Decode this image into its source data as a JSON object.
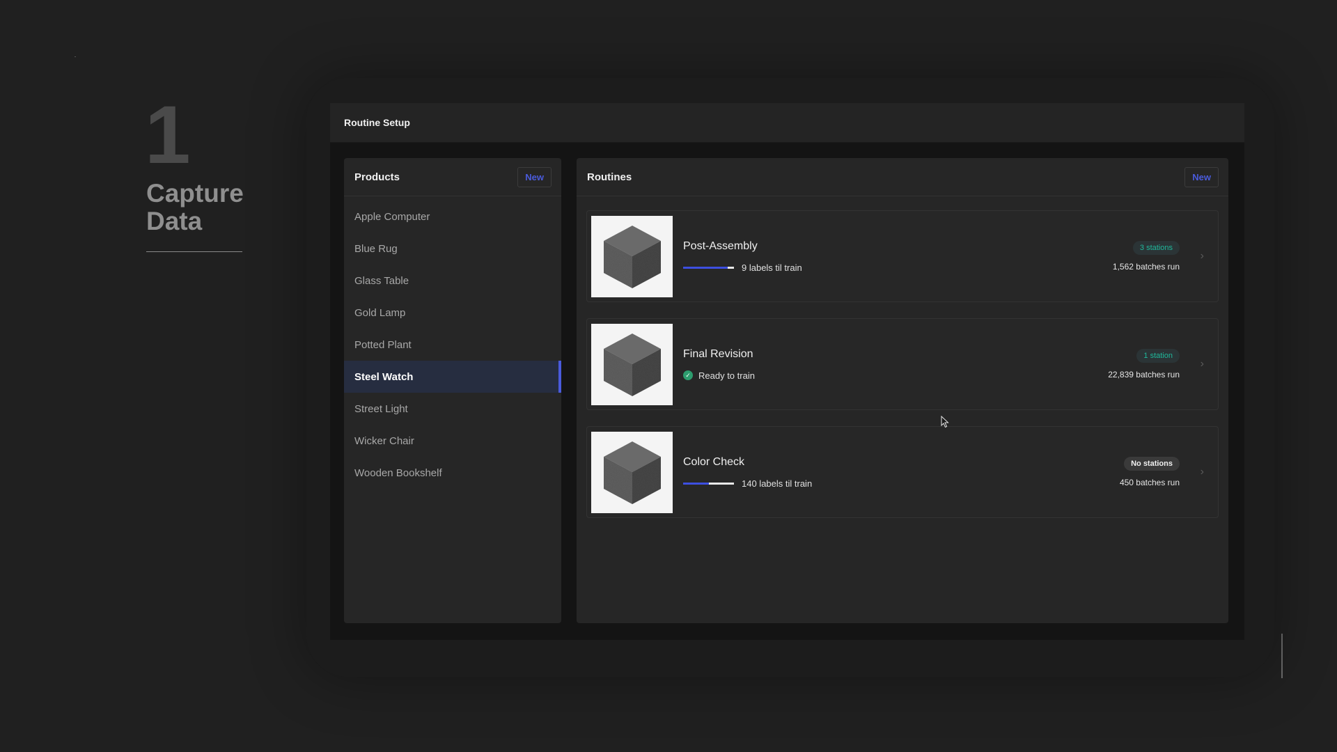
{
  "hero": {
    "number": "1",
    "title": "Capture Data"
  },
  "window": {
    "title": "Routine Setup"
  },
  "products": {
    "title": "Products",
    "new_label": "New",
    "items": [
      {
        "label": "Apple Computer",
        "active": false
      },
      {
        "label": "Blue Rug",
        "active": false
      },
      {
        "label": "Glass Table",
        "active": false
      },
      {
        "label": "Gold Lamp",
        "active": false
      },
      {
        "label": "Potted Plant",
        "active": false
      },
      {
        "label": "Steel Watch",
        "active": true
      },
      {
        "label": "Street Light",
        "active": false
      },
      {
        "label": "Wicker Chair",
        "active": false
      },
      {
        "label": "Wooden Bookshelf",
        "active": false
      }
    ]
  },
  "routines": {
    "title": "Routines",
    "new_label": "New",
    "items": [
      {
        "name": "Post-Assembly",
        "status_type": "progress",
        "status_text": "9 labels til train",
        "progress": 0.88,
        "badge": "3 stations",
        "badge_style": "teal",
        "batches": "1,562 batches run"
      },
      {
        "name": "Final Revision",
        "status_type": "ready",
        "status_text": "Ready to train",
        "progress": null,
        "badge": "1 station",
        "badge_style": "teal",
        "batches": "22,839 batches run"
      },
      {
        "name": "Color Check",
        "status_type": "progress",
        "status_text": "140 labels til train",
        "progress": 0.5,
        "badge": "No stations",
        "badge_style": "grey",
        "batches": "450 batches run"
      }
    ]
  },
  "colors": {
    "accent": "#3d4fe0",
    "teal": "#1fb89b",
    "ready": "#2d9d6e",
    "active_row": "#262d40"
  },
  "icons": {
    "thumbnail": "cube-icon",
    "chevron": "chevron-right-icon",
    "ready": "check-circle-icon",
    "pointer": "mouse-cursor-icon"
  }
}
